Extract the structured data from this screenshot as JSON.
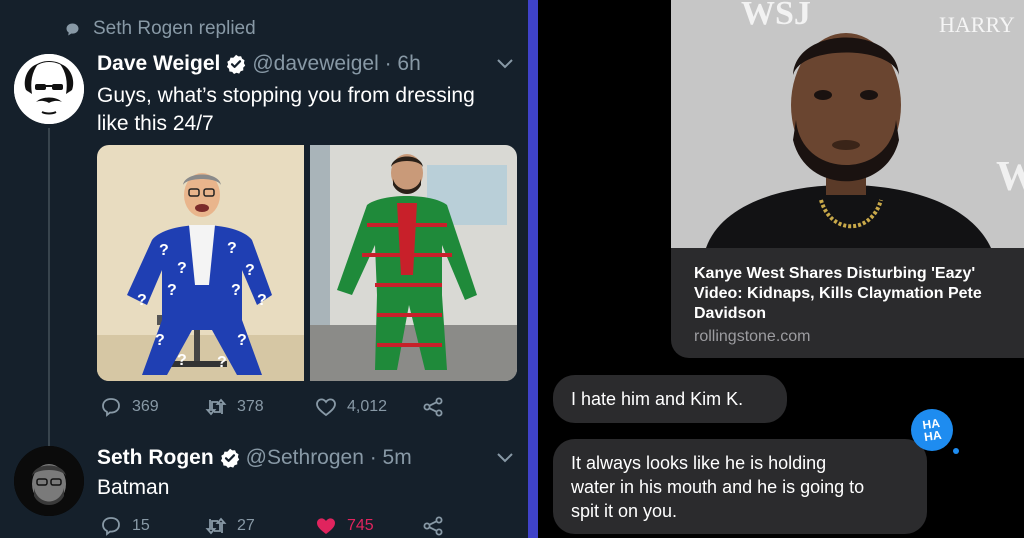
{
  "twitter": {
    "replied_label": "Seth Rogen replied",
    "tweet1": {
      "name": "Dave Weigel",
      "handle": "@daveweigel · 6h",
      "text_line1": "Guys, what’s stopping you from dressing",
      "text_line2": "like this 24/7",
      "replies": "369",
      "retweets": "378",
      "likes": "4,012"
    },
    "tweet2": {
      "name": "Seth Rogen",
      "handle": "@Sethrogen · 5m",
      "text": "Batman",
      "replies": "15",
      "retweets": "27",
      "likes": "745",
      "liked": true
    },
    "colors": {
      "background": "#15202b",
      "secondary_text": "#8899a6",
      "verified": "#ffffff",
      "like_active": "#e0245e"
    }
  },
  "messages": {
    "link_preview": {
      "image_text_left": "WSJ",
      "image_text_right": "HARRY",
      "title_line1": "Kanye West Shares Disturbing 'Eazy'",
      "title_line2": "Video: Kidnaps, Kills Claymation Pete",
      "title_line3": "Davidson",
      "domain": "rollingstone.com"
    },
    "bubble1": "I hate him and Kim K.",
    "bubble2_line1": "It always looks like he is holding",
    "bubble2_line2": "water in his mouth and he is going to",
    "bubble2_line3": "spit it on you.",
    "reaction": "HA HA",
    "reaction_icon": "haha-reaction-icon",
    "colors": {
      "bubble": "#2b2b2d",
      "reaction": "#1e8cf0"
    }
  },
  "divider_color": "#3f42c9"
}
